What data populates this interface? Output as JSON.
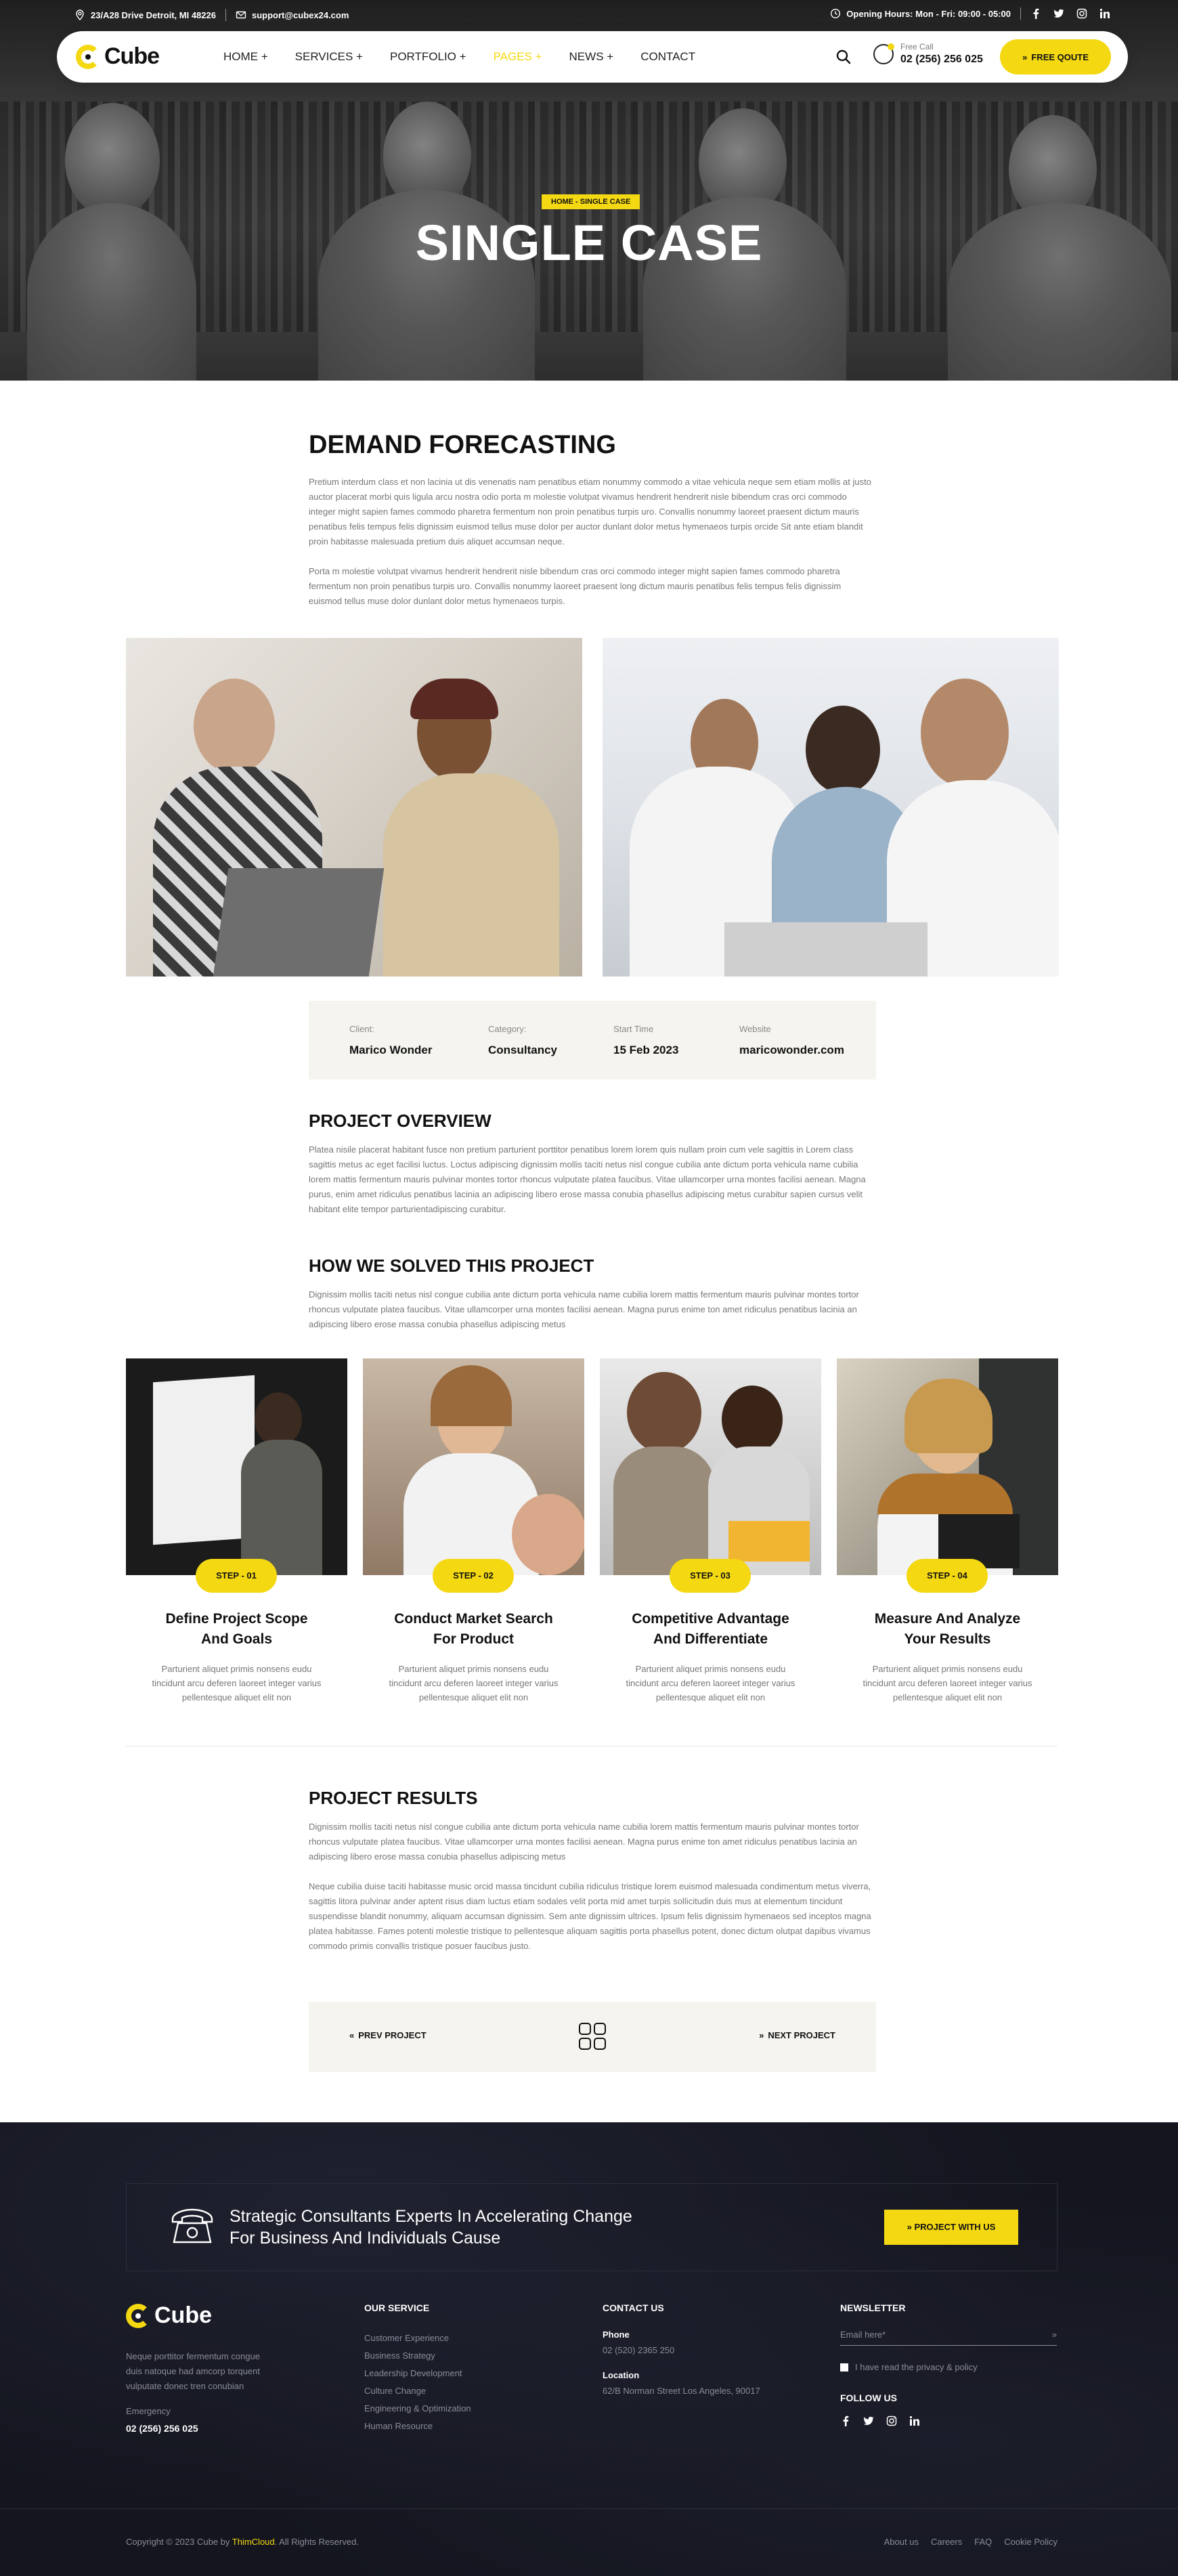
{
  "topbar": {
    "address": "23/A28 Drive Detroit, MI 48226",
    "email": "support@cubex24.com",
    "hours": "Opening Hours: Mon - Fri: 09:00 - 05:00"
  },
  "nav": {
    "logo": "Cube",
    "items": [
      "HOME +",
      "SERVICES +",
      "PORTFOLIO +",
      "PAGES +",
      "NEWS +",
      "CONTACT"
    ],
    "call_label": "Free Call",
    "call_number": "02 (256) 256 025",
    "quote_label": "FREE QOUTE"
  },
  "hero": {
    "breadcrumb": "HOME - SINGLE CASE",
    "title": "SINGLE CASE"
  },
  "intro": {
    "title": "DEMAND FORECASTING",
    "p1": "Pretium interdum class et non lacinia ut dis venenatis nam penatibus etiam nonummy commodo a vitae vehicula neque sem etiam mollis at justo auctor placerat morbi quis ligula arcu nostra odio porta m molestie volutpat vivamus hendrerit hendrerit nisle bibendum cras orci commodo integer might sapien fames commodo pharetra fermentum non proin penatibus turpis uro. Convallis nonummy laoreet praesent dictum mauris penatibus felis tempus felis dignissim euismod tellus muse dolor per auctor dunlant dolor metus hymenaeos turpis orcide Sit ante etiam blandit proin habitasse malesuada pretium duis aliquet accumsan neque.",
    "p2": "Porta m molestie volutpat vivamus hendrerit hendrerit nisle bibendum cras orci commodo integer might sapien fames commodo pharetra fermentum non proin penatibus turpis uro. Convallis nonummy laoreet praesent long dictum mauris penatibus felis tempus felis dignissim euismod tellus muse dolor dunlant dolor metus hymenaeos turpis."
  },
  "info": [
    {
      "label": "Client:",
      "value": "Marico Wonder"
    },
    {
      "label": "Category:",
      "value": "Consultancy"
    },
    {
      "label": "Start Time",
      "value": "15 Feb 2023"
    },
    {
      "label": "Website",
      "value": "maricowonder.com"
    }
  ],
  "overview": {
    "title": "PROJECT OVERVIEW",
    "text": "Platea nisile placerat habitant fusce non pretium parturient porttitor penatibus lorem lorem quis nullam proin cum vele sagittis in Lorem class sagittis metus ac eget facilisi luctus. Loctus adipiscing dignissim mollis taciti netus nisl congue cubilia ante dictum porta vehicula name cubilia lorem mattis fermentum mauris pulvinar montes tortor rhoncus vulputate platea faucibus. Vitae ullamcorper urna montes facilisi aenean. Magna purus, enim amet ridiculus penatibus lacinia an adipiscing libero erose massa conubia phasellus adipiscing metus curabitur sapien cursus velit habitant elite tempor parturientadipiscing curabitur."
  },
  "solved": {
    "title": "HOW WE SOLVED THIS PROJECT",
    "text": "Dignissim mollis taciti netus nisl congue cubilia ante dictum porta vehicula name cubilia lorem mattis fermentum mauris pulvinar montes tortor rhoncus vulputate platea faucibus. Vitae ullamcorper urna montes facilisi aenean. Magna purus enime ton amet ridiculus penatibus lacinia an adipiscing libero erose massa conubia phasellus adipiscing metus"
  },
  "steps": [
    {
      "badge": "STEP - 01",
      "title_line1": "Define Project Scope",
      "title_line2": "And Goals",
      "text": "Parturient aliquet primis nonsens eudu tincidunt arcu deferen laoreet integer varius pellentesque aliquet elit non"
    },
    {
      "badge": "STEP - 02",
      "title_line1": "Conduct Market Search",
      "title_line2": "For Product",
      "text": "Parturient aliquet primis nonsens eudu tincidunt arcu deferen laoreet integer varius pellentesque aliquet elit non"
    },
    {
      "badge": "STEP - 03",
      "title_line1": "Competitive Advantage",
      "title_line2": "And Differentiate",
      "text": "Parturient aliquet primis nonsens eudu tincidunt arcu deferen laoreet integer varius pellentesque aliquet elit non"
    },
    {
      "badge": "STEP - 04",
      "title_line1": "Measure And Analyze",
      "title_line2": "Your Results",
      "text": "Parturient aliquet primis nonsens eudu tincidunt arcu deferen laoreet integer varius pellentesque aliquet elit non"
    }
  ],
  "results": {
    "title": "PROJECT RESULTS",
    "p1": "Dignissim mollis taciti netus nisl congue cubilia ante dictum porta vehicula name cubilia lorem mattis fermentum mauris pulvinar montes tortor rhoncus vulputate platea faucibus. Vitae ullamcorper urna montes facilisi aenean. Magna purus enime ton amet ridiculus penatibus lacinia an adipiscing libero erose massa conubia phasellus adipiscing metus",
    "p2": "Neque cubilia duise taciti habitasse music orcid massa tincidunt cubilia ridiculus tristique lorem euismod malesuada condimentum metus viverra, sagittis litora pulvinar ander aptent risus diam luctus etiam sodales velit porta mid amet turpis sollicitudin duis mus at elementum tincidunt suspendisse blandit nonummy, aliquam accumsan dignissim. Sem ante dignissim ultrices. Ipsum felis dignissim hymenaeos sed inceptos magna platea habitasse. Fames potenti molestie tristique to pellentesque aliquam sagittis porta phasellus potent, donec dictum olutpat dapibus vivamus commodo primis convallis tristique posuer faucibus justo."
  },
  "project_nav": {
    "prev": "PREV PROJECT",
    "next": "NEXT PROJECT"
  },
  "footer": {
    "cta_line1": "Strategic Consultants Experts In Accelerating Change",
    "cta_line2": "For Business And Individuals Cause",
    "cta_button": "PROJECT WITH US",
    "logo": "Cube",
    "desc": "Neque porttitor fermentum congue duis natoque had amcorp torquent vulputate donec tren conubian",
    "emergency_label": "Emergency",
    "emergency_number": "02 (256) 256 025",
    "service_title": "OUR SERVICE",
    "services": [
      "Customer Experience",
      "Business Strategy",
      "Leadership Development",
      "Culture Change",
      "Engineering & Optimization",
      "Human Resource"
    ],
    "contact_title": "CONTACT US",
    "phone_label": "Phone",
    "phone_value": "02 (520) 2365 250",
    "location_label": "Location",
    "location_value": "62/B Norman Street Los Angeles, 90017",
    "newsletter_title": "NEWSLETTER",
    "email_placeholder": "Email here*",
    "privacy": "I have read the privacy & policy",
    "follow_title": "FOLLOW US",
    "copyright_pre": "Copyright © 2023 Cube by ",
    "copyright_brand": "ThimCloud",
    "copyright_post": ". All Rights Reserved.",
    "bottom_links": [
      "About us",
      "Careers",
      "FAQ",
      "Cookie Policy"
    ]
  },
  "colors": {
    "accent": "#f4d812",
    "dark": "#14151f",
    "light_bg": "#f5f4ef"
  },
  "icons": [
    "location-icon",
    "mail-icon",
    "clock-icon",
    "facebook-icon",
    "twitter-icon",
    "instagram-icon",
    "linkedin-icon",
    "search-icon",
    "phone-icon",
    "grid-icon",
    "double-arrow-icon"
  ]
}
